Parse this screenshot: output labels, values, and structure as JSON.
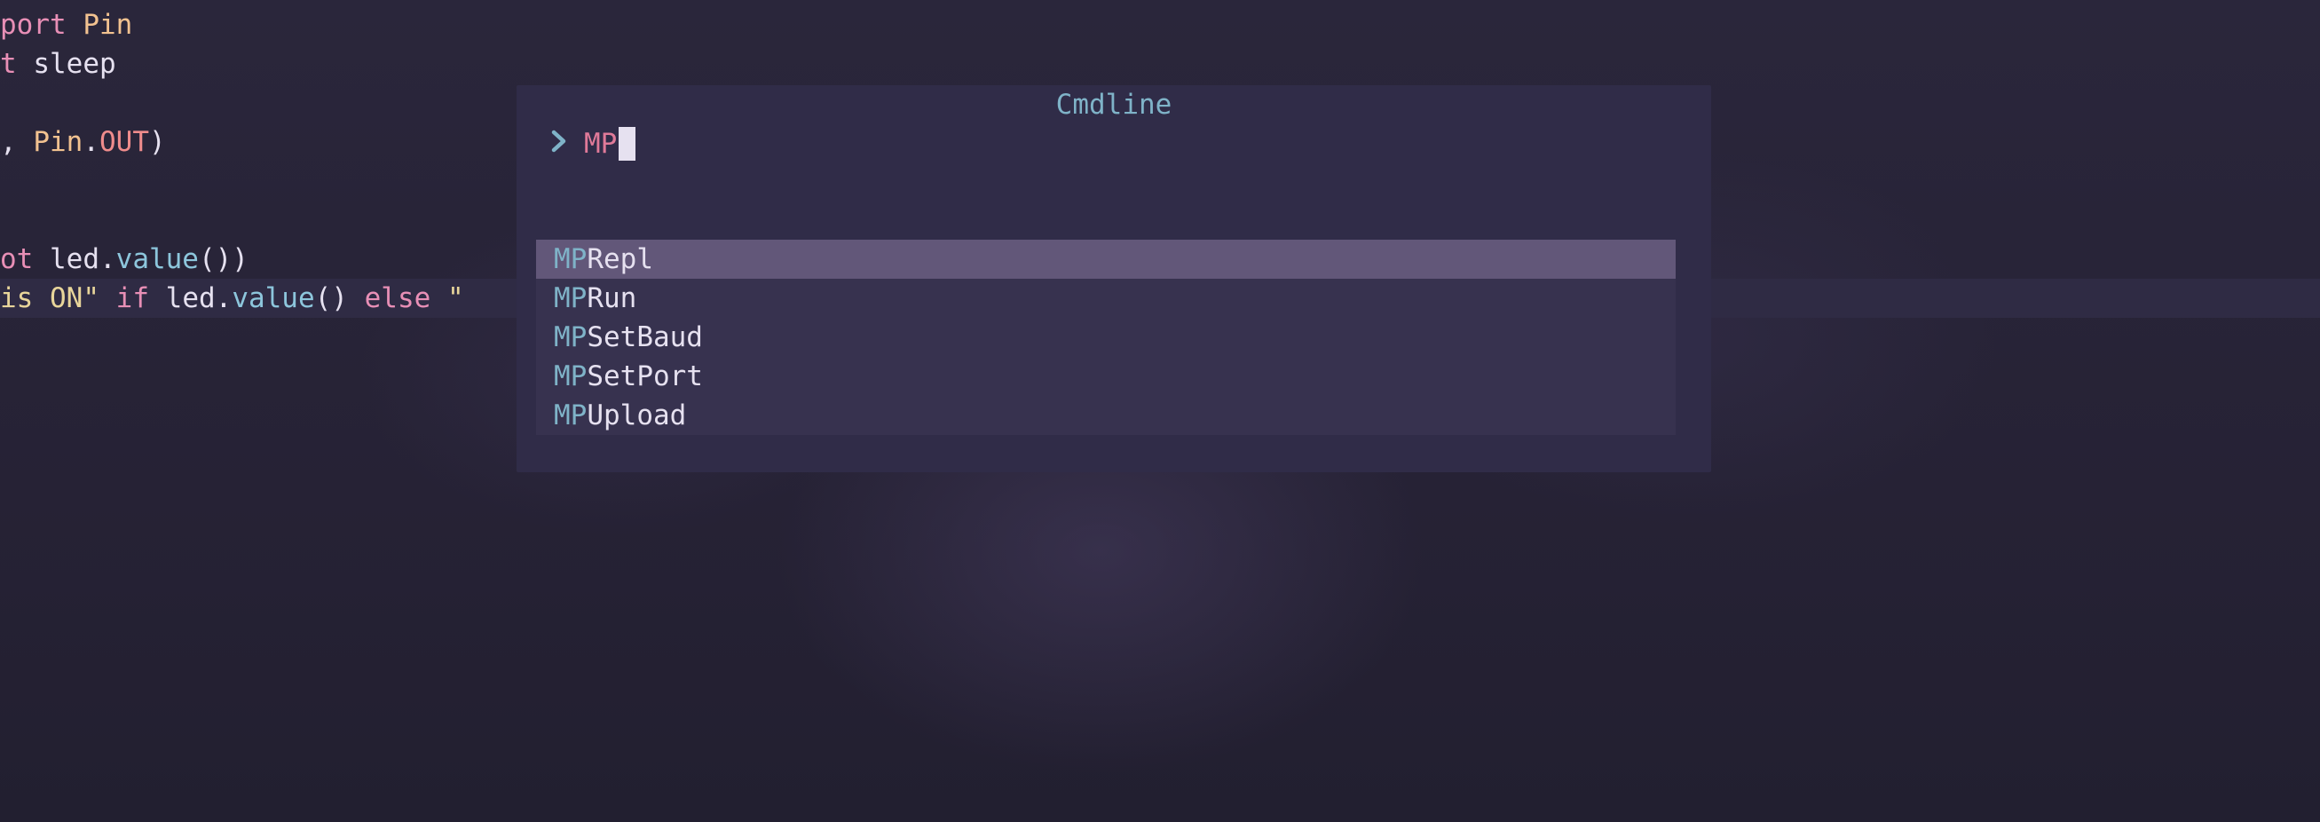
{
  "editor": {
    "lines": [
      [
        {
          "t": "port ",
          "c": "kw"
        },
        {
          "t": "Pin",
          "c": "cls"
        }
      ],
      [
        {
          "t": "t ",
          "c": "kw"
        },
        {
          "t": "sleep",
          "c": "plain"
        }
      ],
      [],
      [
        {
          "t": ", ",
          "c": "plain"
        },
        {
          "t": "Pin",
          "c": "cls"
        },
        {
          "t": ".",
          "c": "plain"
        },
        {
          "t": "OUT",
          "c": "attr"
        },
        {
          "t": ")",
          "c": "plain"
        }
      ],
      [],
      [],
      [
        {
          "t": "ot ",
          "c": "kw"
        },
        {
          "t": "led.",
          "c": "plain"
        },
        {
          "t": "value",
          "c": "fn"
        },
        {
          "t": "())",
          "c": "plain"
        }
      ],
      [
        {
          "t": "is ON\" ",
          "c": "str"
        },
        {
          "t": "if ",
          "c": "kw"
        },
        {
          "t": "led.",
          "c": "plain"
        },
        {
          "t": "value",
          "c": "fn"
        },
        {
          "t": "() ",
          "c": "plain"
        },
        {
          "t": "else ",
          "c": "kw"
        },
        {
          "t": "\"",
          "c": "str"
        }
      ]
    ]
  },
  "cmdline": {
    "title": "Cmdline",
    "prompt_icon": "chevron-right-icon",
    "input_value": "MP"
  },
  "completion": {
    "selected_index": 0,
    "items": [
      {
        "match": "MP",
        "rest": "Repl"
      },
      {
        "match": "MP",
        "rest": "Run"
      },
      {
        "match": "MP",
        "rest": "SetBaud"
      },
      {
        "match": "MP",
        "rest": "SetPort"
      },
      {
        "match": "MP",
        "rest": "Upload"
      }
    ]
  },
  "colors": {
    "background": "#262335",
    "popup": "#302c48",
    "selection": "#625779",
    "accent": "#7fb3c8",
    "prompt_text": "#e07a99"
  }
}
